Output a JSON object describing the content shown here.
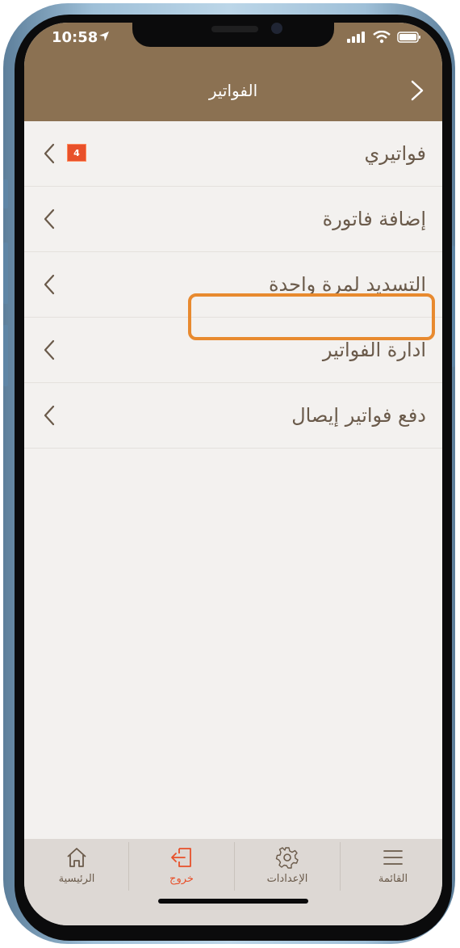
{
  "status_bar": {
    "time": "10:58"
  },
  "header": {
    "title": "الفواتير"
  },
  "menu": {
    "items": [
      {
        "label": "فواتيري",
        "badge": "4"
      },
      {
        "label": "إضافة فاتورة"
      },
      {
        "label": "التسديد لمرة واحدة"
      },
      {
        "label": "ادارة الفواتير"
      },
      {
        "label": "دفع فواتير إيصال"
      }
    ]
  },
  "tabbar": {
    "tabs": [
      {
        "label": "الرئيسية",
        "icon": "home-icon"
      },
      {
        "label": "خروج",
        "icon": "logout-icon",
        "active": true
      },
      {
        "label": "الإعدادات",
        "icon": "gear-icon"
      },
      {
        "label": "القائمة",
        "icon": "menu-icon"
      }
    ]
  },
  "colors": {
    "header": "#8b7152",
    "accent": "#e88a2f",
    "active_tab": "#e8502a",
    "text": "#6a5a4a"
  }
}
